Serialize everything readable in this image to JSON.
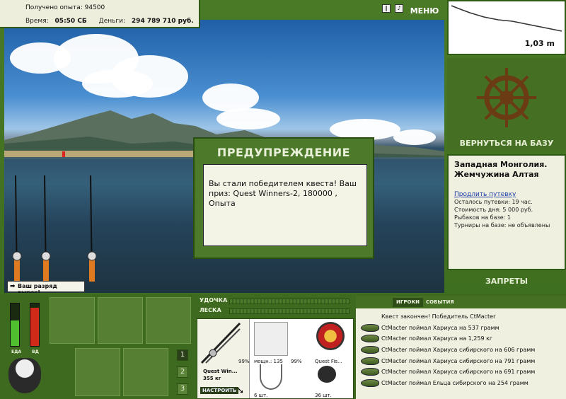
{
  "info": {
    "experience_label": "Получено опыта:",
    "experience_value": "94500",
    "time_label": "Время:",
    "time_value": "05:50 СБ",
    "money_label": "Деньги:",
    "money_value": "294 789 710 руб."
  },
  "header": {
    "menu_label": "МЕНЮ",
    "icon_1": "pause-icon",
    "icon_2": "sound-icon"
  },
  "depth": {
    "value": "1,03 m"
  },
  "warning": {
    "title": "ПРЕДУПРЕЖДЕНИЕ",
    "text": "Вы стали победителем квеста! Ваш приз: Quest Winners-2, 180000 , Опыта"
  },
  "rank_toast": "Ваш разряд вырос!",
  "base": {
    "return_label": "ВЕРНУТЬСЯ НА БАЗУ",
    "location_title": "Западная Монголия. Жемчужина Алтая",
    "extend_link": "Продлить путевку",
    "lines": [
      "Осталось путевки: 19 час.",
      "Стоимость дня: 5 000 руб.",
      "Рыбаков на базе: 1",
      "Турниры на базе: не объявлены"
    ],
    "bans_label": "ЗАПРЕТЫ"
  },
  "meters": {
    "left_label": "ЕДА",
    "right_label": "ВД",
    "left_level": 0.6,
    "right_level": 0.9
  },
  "pages": [
    "1",
    "2",
    "3"
  ],
  "bars": {
    "rod_label": "УДОЧКА",
    "line_label": "ЛЕСКА"
  },
  "tackle": {
    "rod_name": "Quest Win...",
    "rod_weight": "355 кг",
    "rod_percent": "99%",
    "setup_label": "НАСТРОИТЬ",
    "reel_label": "мощн.: 135",
    "reel_percent": "99%",
    "lure_label": "Quest Fis...",
    "hooks_label": "6 шт.",
    "bait_label": "36 шт."
  },
  "events": {
    "tab_players": "ИГРОКИ",
    "tab_events": "СОБЫТИЯ",
    "rows": [
      "Квест закончен! Победитель CtMacter",
      "CtMacter поймал Хариуса на 537 грамм",
      "CtMacter поймал Хариуса на 1,259 кг",
      "CtMacter поймал Хариуса сибирского на 606 грамм",
      "CtMacter поймал Хариуса сибирского на 791 грамм",
      "CtMacter поймал Хариуса сибирского на 691 грамм",
      "CtMacter поймал Ельца сибирского на 254 грамм"
    ]
  },
  "colors": {
    "panel_green": "#3e6a1f",
    "accent_green": "#4d7a2a",
    "card_bg": "#f0f0e0"
  }
}
